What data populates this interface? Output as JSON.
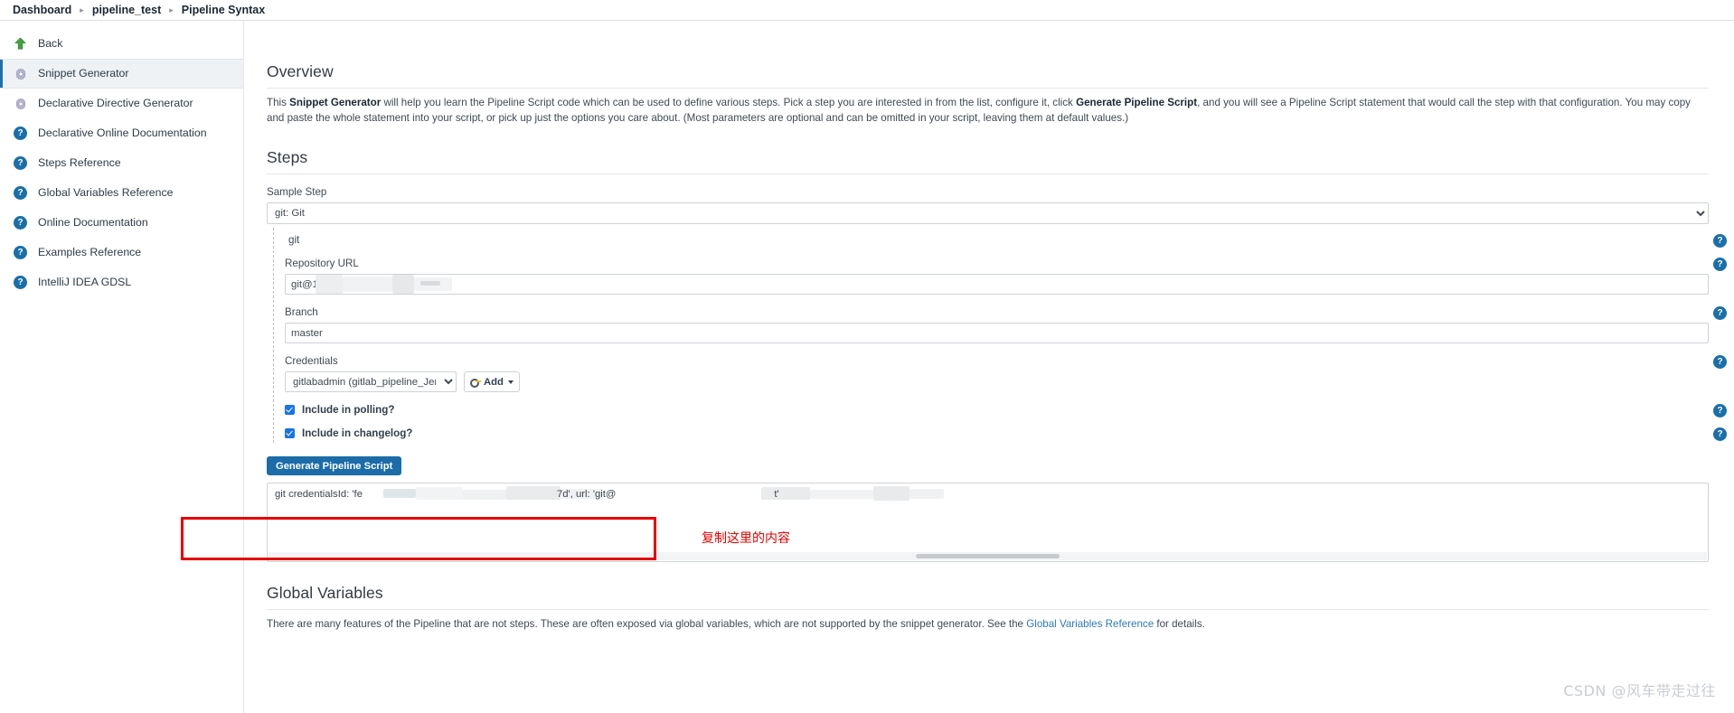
{
  "breadcrumb": {
    "items": [
      "Dashboard",
      "pipeline_test",
      "Pipeline Syntax"
    ],
    "separator": "▸"
  },
  "sidebar": {
    "items": [
      {
        "label": "Back",
        "icon": "up-arrow-icon",
        "selected": false
      },
      {
        "label": "Snippet Generator",
        "icon": "gear-icon",
        "selected": true
      },
      {
        "label": "Declarative Directive Generator",
        "icon": "gear-icon",
        "selected": false
      },
      {
        "label": "Declarative Online Documentation",
        "icon": "help-icon",
        "selected": false
      },
      {
        "label": "Steps Reference",
        "icon": "help-icon",
        "selected": false
      },
      {
        "label": "Global Variables Reference",
        "icon": "help-icon",
        "selected": false
      },
      {
        "label": "Online Documentation",
        "icon": "help-icon",
        "selected": false
      },
      {
        "label": "Examples Reference",
        "icon": "help-icon",
        "selected": false
      },
      {
        "label": "IntelliJ IDEA GDSL",
        "icon": "help-icon",
        "selected": false
      }
    ]
  },
  "overview": {
    "heading": "Overview",
    "text_1": "This ",
    "bold_1": "Snippet Generator",
    "text_2": " will help you learn the Pipeline Script code which can be used to define various steps. Pick a step you are interested in from the list, configure it, click ",
    "bold_2": "Generate Pipeline Script",
    "text_3": ", and you will see a Pipeline Script statement that would call the step with that configuration. You may copy and paste the whole statement into your script, or pick up just the options you care about. (Most parameters are optional and can be omitted in your script, leaving them at default values.)"
  },
  "steps": {
    "heading": "Steps",
    "sample_step_label": "Sample Step",
    "sample_step_value": "git: Git",
    "nested_title": "git",
    "repository_url_label": "Repository URL",
    "repository_url_value": "git@1",
    "branch_label": "Branch",
    "branch_value": "master",
    "credentials_label": "Credentials",
    "credentials_value": "gitlabadmin (gitlab_pipeline_Jenkins)",
    "add_button_label": "Add",
    "include_polling_label": "Include in polling?",
    "include_changelog_label": "Include in changelog?",
    "generate_button_label": "Generate Pipeline Script",
    "generated_script_prefix": "git credentialsId: 'fe",
    "generated_script_mid": "7d', url: 'git@",
    "generated_script_suffix": "t'"
  },
  "annotation": {
    "text": "复制这里的内容",
    "color": "#e60000"
  },
  "globals": {
    "heading": "Global Variables",
    "text_1": "There are many features of the Pipeline that are not steps. These are often exposed via global variables, which are not supported by the snippet generator. See the ",
    "link": "Global Variables Reference",
    "text_2": " for details."
  },
  "watermark": {
    "text": "CSDN @风车带走过往"
  },
  "icons": {
    "help": "?",
    "caret_down": "▾"
  },
  "colors": {
    "accent_blue": "#1b6ca8",
    "link_blue": "#2e7bb5",
    "annotation_red": "#e60000",
    "selected_bg": "#eef2f5"
  }
}
